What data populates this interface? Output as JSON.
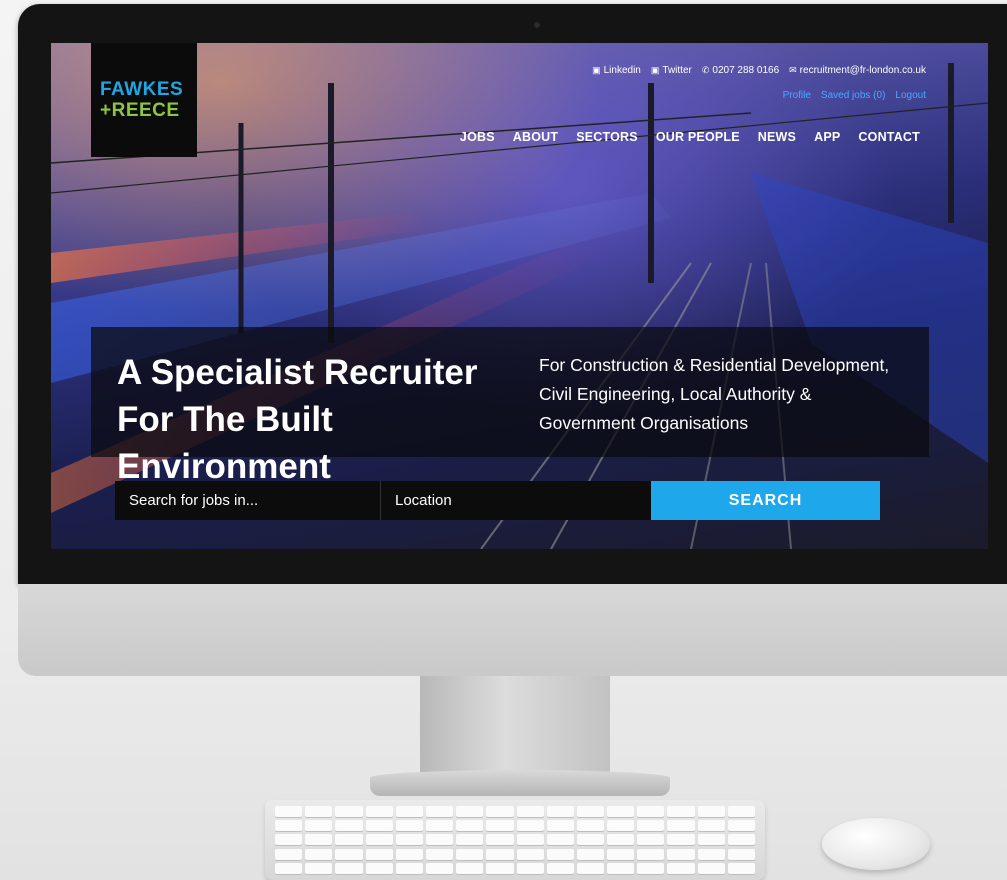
{
  "site": {
    "logo": {
      "line1": "FAWKES",
      "line2": "+REECE"
    },
    "contact": {
      "linkedin": "Linkedin",
      "twitter": "Twitter",
      "phone": "0207 288 0166",
      "email": "recruitment@fr-london.co.uk"
    },
    "account_links": [
      "Profile",
      "Saved jobs (0)",
      "Logout"
    ],
    "nav": [
      "JOBS",
      "ABOUT",
      "SECTORS",
      "OUR PEOPLE",
      "NEWS",
      "APP",
      "CONTACT"
    ],
    "hero": {
      "title": "A Specialist Recruiter For The Built Environment",
      "subtitle": "For Construction & Residential Development, Civil Engineering, Local Authority & Government Organisations"
    },
    "search": {
      "keyword_placeholder": "Search for jobs in...",
      "location_placeholder": "Location",
      "button_label": "SEARCH"
    }
  },
  "colors": {
    "brand_blue": "#1ea7e4",
    "brand_green": "#8dc63f",
    "search_button": "#1ea7ea",
    "link_blue": "#4aa8ff"
  },
  "icons": {
    "linkedin": "linkedin-icon",
    "twitter": "twitter-icon",
    "phone": "phone-icon",
    "email": "envelope-icon"
  }
}
